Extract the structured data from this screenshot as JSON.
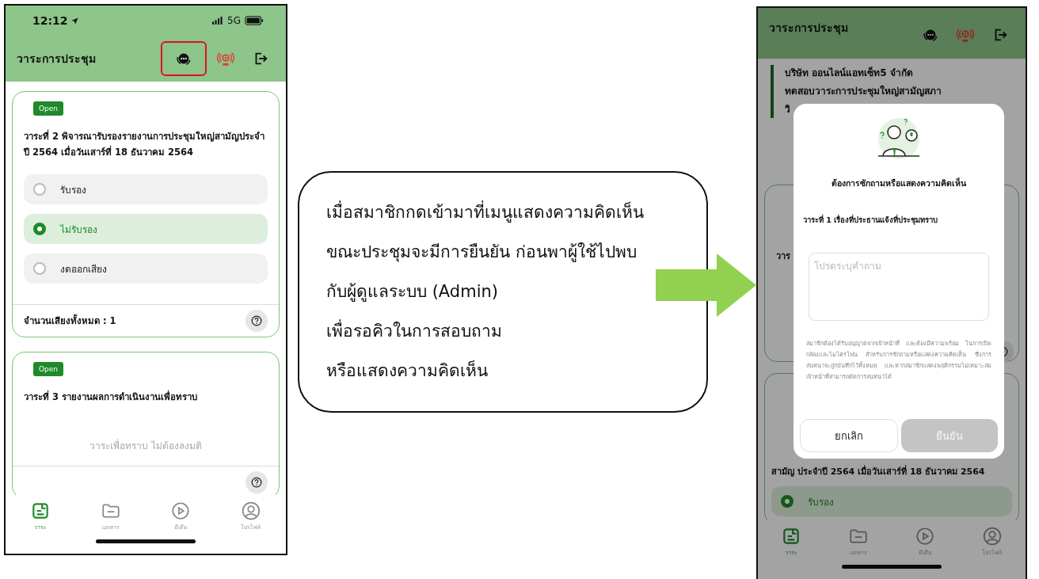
{
  "left_phone": {
    "status_bar": {
      "time": "12:12",
      "network": "5G"
    },
    "header": {
      "title": "วาระการประชุม",
      "actions": [
        {
          "kind": "chat",
          "highlighted": true
        },
        {
          "kind": "live",
          "highlighted": false
        },
        {
          "kind": "logout",
          "highlighted": false
        }
      ]
    },
    "agenda_cards": [
      {
        "badge": "Open",
        "title": "วาระที่ 2 พิจารณารับรองรายงานการประชุมใหญ่สามัญประจำปี 2564 เมื่อวันเสาร์ที่ 18 ธันวาคม 2564",
        "options": [
          {
            "label": "รับรอง",
            "selected": false
          },
          {
            "label": "ไม่รับรอง",
            "selected": true
          },
          {
            "label": "งดออกเสียง",
            "selected": false
          }
        ],
        "total": "จำนวนเสียงทั้งหมด : 1"
      },
      {
        "badge": "Open",
        "title": "วาระที่ 3 รายงานผลการดำเนินงานเพื่อทราบ",
        "note": "วาระเพื่อทราบ ไม่ต้องลงมติ"
      }
    ],
    "tab_bar": [
      {
        "kind": "agenda",
        "label": "วาระ",
        "selected": true
      },
      {
        "kind": "documents",
        "label": "เอกสาร",
        "selected": false
      },
      {
        "kind": "media",
        "label": "มีเดีย",
        "selected": false
      },
      {
        "kind": "profile",
        "label": "โปรไฟล์",
        "selected": false
      }
    ]
  },
  "callout": {
    "lines": [
      "เมื่อสมาชิกกดเข้ามาที่เมนูแสดงความคิดเห็น",
      "ขณะประชุมจะมีการยืนยัน ก่อนพาผู้ใช้ไปพบ",
      "กับผู้ดูแลระบบ (Admin)",
      "เพื่อรอคิวในการสอบถาม",
      "หรือแสดงความคิดเห็น"
    ]
  },
  "right_phone": {
    "header": {
      "title": "วาระการประชุม",
      "actions": [
        {
          "kind": "chat",
          "highlighted": false
        },
        {
          "kind": "live",
          "highlighted": false
        },
        {
          "kind": "logout",
          "highlighted": false
        }
      ]
    },
    "company": {
      "lines": [
        "บริษัท ออนไลน์แอทเซ็ท5 จำกัด",
        "ทดสอบวาระการประชุมใหญ่สามัญสภา",
        "วิ"
      ]
    },
    "card_fragment": "วาร",
    "second_card": {
      "title": "สามัญ ประจำปี 2564 เมื่อวันเสาร์ที่ 18 ธันวาคม 2564",
      "options": [
        {
          "label": "รับรอง",
          "selected": true
        }
      ]
    },
    "modal": {
      "title": "ต้องการซักถามหรือแสดงความคิดเห็น",
      "agenda": "วาระที่ 1 เรื่องที่ประธานแจ้งที่ประชุมทราบ",
      "placeholder": "โปรดระบุคำถาม",
      "notice": "สมาชิกต้องได้รับอนุญาตจากเจ้าหน้าที่ และต้องมีความพร้อม ในการเปิดกล้องและไมโครโฟน  สำหรับการซักถามหรือแสดงความคิดเห็น ซึ่งการสนทนาจะถูกบันทึกไว้ทั้งหมด  และหากสมาชิกแสดงพฤติกรรมไม่เหมาะสม เจ้าหน้าที่สามารถตัดการสนทนาได้",
      "buttons": [
        {
          "label": "ยกเลิก",
          "disabled": false
        },
        {
          "label": "ยืนยัน",
          "disabled": true
        }
      ]
    },
    "tab_bar": [
      {
        "kind": "agenda",
        "label": "วาระ",
        "selected": true
      },
      {
        "kind": "documents",
        "label": "เอกสาร",
        "selected": false
      },
      {
        "kind": "media",
        "label": "มีเดีย",
        "selected": false
      },
      {
        "kind": "profile",
        "label": "โปรไฟล์",
        "selected": false
      }
    ]
  }
}
